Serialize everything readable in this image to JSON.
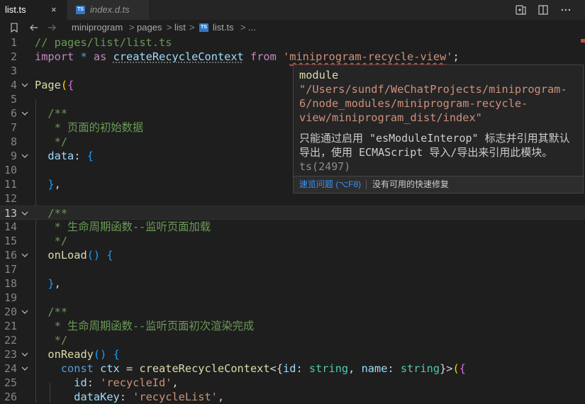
{
  "tabs": [
    {
      "label": "list.ts",
      "close_icon": "×"
    },
    {
      "label": "index.d.ts",
      "badge": "TS"
    }
  ],
  "breadcrumb": {
    "items": [
      "miniprogram",
      "pages",
      "list",
      "list.ts",
      "..."
    ],
    "separator": ">",
    "file_badge": "TS"
  },
  "editor": {
    "lines": [
      {
        "n": "1",
        "segs": [
          [
            "c",
            "// pages/list/list.ts"
          ]
        ]
      },
      {
        "n": "2",
        "segs": [
          [
            "kc",
            "import"
          ],
          [
            "p",
            " "
          ],
          [
            "k",
            "*"
          ],
          [
            "p",
            " "
          ],
          [
            "kc",
            "as"
          ],
          [
            "p",
            " "
          ],
          [
            "v",
            "createRecycleContext"
          ],
          [
            "p",
            " "
          ],
          [
            "kc",
            "from"
          ],
          [
            "p",
            " "
          ],
          [
            "s",
            "'"
          ],
          [
            "ssq",
            "miniprogram-recycle-view"
          ],
          [
            "s",
            "'"
          ],
          [
            "p",
            ";"
          ]
        ]
      },
      {
        "n": "3",
        "segs": []
      },
      {
        "n": "4",
        "fold": true,
        "segs": [
          [
            "f",
            "Page"
          ],
          [
            "y",
            "("
          ],
          [
            "pk",
            "{"
          ]
        ]
      },
      {
        "n": "5",
        "segs": []
      },
      {
        "n": "6",
        "fold": true,
        "segs": [
          [
            "p",
            "  "
          ],
          [
            "c",
            "/**"
          ]
        ]
      },
      {
        "n": "7",
        "segs": [
          [
            "c",
            "   * 页面的初始数据"
          ]
        ]
      },
      {
        "n": "8",
        "segs": [
          [
            "c",
            "   */"
          ]
        ]
      },
      {
        "n": "9",
        "fold": true,
        "segs": [
          [
            "p",
            "  "
          ],
          [
            "v",
            "data"
          ],
          [
            "p",
            ": "
          ],
          [
            "bl",
            "{"
          ]
        ]
      },
      {
        "n": "10",
        "segs": []
      },
      {
        "n": "11",
        "segs": [
          [
            "p",
            "  "
          ],
          [
            "bl",
            "}"
          ],
          [
            "p",
            ","
          ]
        ]
      },
      {
        "n": "12",
        "segs": []
      },
      {
        "n": "13",
        "fold": true,
        "active": true,
        "segs": [
          [
            "p",
            "  "
          ],
          [
            "c",
            "/**"
          ]
        ]
      },
      {
        "n": "14",
        "segs": [
          [
            "c",
            "   * 生命周期函数--监听页面加载"
          ]
        ]
      },
      {
        "n": "15",
        "segs": [
          [
            "c",
            "   */"
          ]
        ]
      },
      {
        "n": "16",
        "fold": true,
        "segs": [
          [
            "p",
            "  "
          ],
          [
            "f",
            "onLoad"
          ],
          [
            "bl",
            "()"
          ],
          [
            "p",
            " "
          ],
          [
            "bl",
            "{"
          ]
        ]
      },
      {
        "n": "17",
        "segs": []
      },
      {
        "n": "18",
        "segs": [
          [
            "p",
            "  "
          ],
          [
            "bl",
            "}"
          ],
          [
            "p",
            ","
          ]
        ]
      },
      {
        "n": "19",
        "segs": []
      },
      {
        "n": "20",
        "fold": true,
        "segs": [
          [
            "p",
            "  "
          ],
          [
            "c",
            "/**"
          ]
        ]
      },
      {
        "n": "21",
        "segs": [
          [
            "c",
            "   * 生命周期函数--监听页面初次渲染完成"
          ]
        ]
      },
      {
        "n": "22",
        "segs": [
          [
            "c",
            "   */"
          ]
        ]
      },
      {
        "n": "23",
        "fold": true,
        "segs": [
          [
            "p",
            "  "
          ],
          [
            "f",
            "onReady"
          ],
          [
            "bl",
            "()"
          ],
          [
            "p",
            " "
          ],
          [
            "bl",
            "{"
          ]
        ]
      },
      {
        "n": "24",
        "fold": true,
        "segs": [
          [
            "p",
            "    "
          ],
          [
            "ct",
            "const"
          ],
          [
            "p",
            " "
          ],
          [
            "v",
            "ctx"
          ],
          [
            "p",
            " = "
          ],
          [
            "f",
            "createRecycleContext"
          ],
          [
            "p",
            "<{"
          ],
          [
            "v",
            "id"
          ],
          [
            "p",
            ": "
          ],
          [
            "t",
            "string"
          ],
          [
            "p",
            ", "
          ],
          [
            "v",
            "name"
          ],
          [
            "p",
            ": "
          ],
          [
            "t",
            "string"
          ],
          [
            "p",
            "}>"
          ],
          [
            "y",
            "("
          ],
          [
            "pk",
            "{"
          ]
        ]
      },
      {
        "n": "25",
        "segs": [
          [
            "p",
            "      "
          ],
          [
            "v",
            "id"
          ],
          [
            "p",
            ": "
          ],
          [
            "s",
            "'recycleId'"
          ],
          [
            "p",
            ","
          ]
        ]
      },
      {
        "n": "26",
        "segs": [
          [
            "p",
            "      "
          ],
          [
            "v",
            "dataKey"
          ],
          [
            "p",
            ": "
          ],
          [
            "s",
            "'recycleList'"
          ],
          [
            "p",
            ","
          ]
        ]
      }
    ]
  },
  "hover": {
    "keyword": "module",
    "path_lines": [
      "\"/Users/sundf/WeChatProjects/miniprogram-",
      "6/node_modules/miniprogram-recycle-",
      "view/miniprogram_dist/index\""
    ],
    "message": "只能通过启用 \"esModuleInterop\" 标志并引用其默认导出，使用 ECMAScript 导入/导出来引用此模块。",
    "code": "ts(2497)",
    "action_link": "速览问题 (⌥F8)",
    "no_fix": "没有可用的快速修复"
  }
}
